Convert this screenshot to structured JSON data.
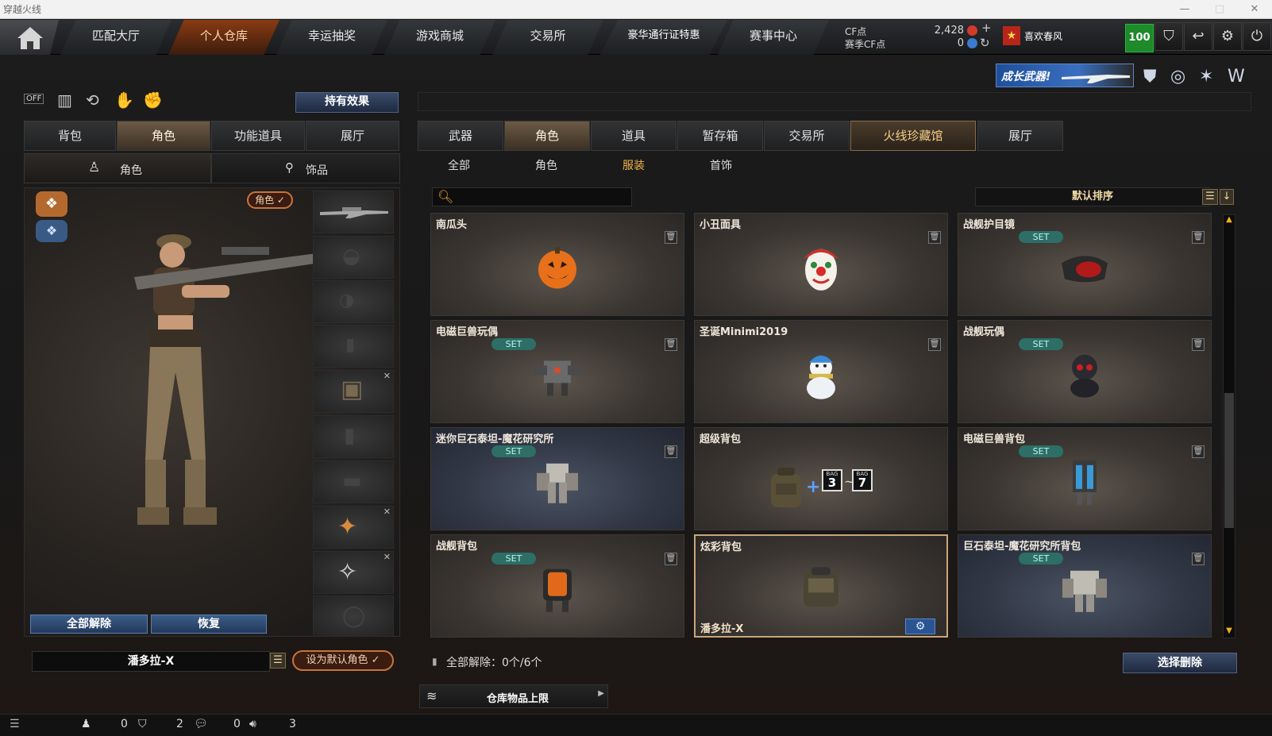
{
  "window": {
    "title": "穿越火线",
    "controls": [
      "—",
      "□",
      "✕"
    ]
  },
  "topnav": {
    "tabs": [
      {
        "label": "匹配大厅"
      },
      {
        "label": "个人仓库"
      },
      {
        "label": "幸运抽奖"
      },
      {
        "label": "游戏商城"
      },
      {
        "label": "交易所"
      },
      {
        "label": "豪华通行证特惠"
      },
      {
        "label": "赛事中心"
      }
    ],
    "active_index": 1,
    "cf_label": "CF点",
    "cf_value": "2,428",
    "season_label": "赛季CF点",
    "season_value": "0",
    "plus": "+",
    "player_name": "喜欢春风",
    "level": "100"
  },
  "banner": {
    "text": "成长武器!"
  },
  "left": {
    "hold_effect": "持有效果",
    "tabs": [
      "背包",
      "角色",
      "功能道具",
      "展厅"
    ],
    "active_tab": 1,
    "subtabs": [
      "角色",
      "饰品"
    ],
    "role_badge": "角色 ✓",
    "unequip_all": "全部解除",
    "restore": "恢复",
    "character_name": "潘多拉-X",
    "set_default": "设为默认角色 ✓"
  },
  "right": {
    "tabs": [
      "武器",
      "角色",
      "道具",
      "暂存箱",
      "交易所",
      "火线珍藏馆",
      "展厅"
    ],
    "active_tab": 1,
    "subtabs": [
      "全部",
      "角色",
      "服装",
      "首饰"
    ],
    "active_subtab": 2,
    "search_placeholder": "",
    "sort_label": "默认排序",
    "items": [
      {
        "name": "南瓜头",
        "set": false
      },
      {
        "name": "小丑面具",
        "set": false
      },
      {
        "name": "战舰护目镜",
        "set": true
      },
      {
        "name": "电磁巨兽玩偶",
        "set": true
      },
      {
        "name": "圣诞Minimi2019",
        "set": false
      },
      {
        "name": "战舰玩偶",
        "set": true
      },
      {
        "name": "迷你巨石泰坦-魔花研究所",
        "set": true
      },
      {
        "name": "超级背包",
        "set": false
      },
      {
        "name": "电磁巨兽背包",
        "set": true
      },
      {
        "name": "战舰背包",
        "set": true
      },
      {
        "name": "炫彩背包",
        "set": false,
        "owner": "潘多拉-X"
      },
      {
        "name": "巨石泰坦-魔花研究所背包",
        "set": true
      }
    ],
    "set_tag": "SET",
    "bag_labels": [
      "BAG",
      "3",
      "BAG",
      "7"
    ],
    "unequip_label": "全部解除：0个/6个",
    "select_delete": "选择删除",
    "storage_limit": "仓库物品上限"
  },
  "statusbar": {
    "counts": [
      "0",
      "2",
      "0",
      "3"
    ]
  },
  "colors": {
    "accent_orange": "#c7743a",
    "set_teal": "#2d6f66",
    "gold": "#f1b44a"
  }
}
